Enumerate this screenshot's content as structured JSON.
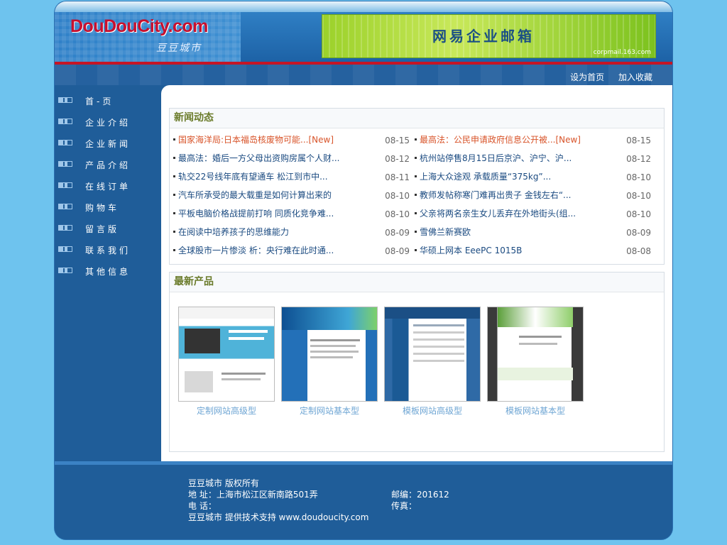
{
  "header": {
    "logo": "DouDouCity.com",
    "logo_sub": "豆豆城市",
    "banner_title": "网易企业邮箱",
    "banner_url": "corpmail.163.com",
    "links": [
      "设为首页",
      "加入收藏"
    ]
  },
  "nav": [
    "首-页",
    "企业介绍",
    "企业新闻",
    "产品介绍",
    "在线订单",
    "购物车",
    "留言版",
    "联系我们",
    "其他信息"
  ],
  "news": {
    "title": "新闻动态",
    "left": [
      {
        "title": "国家海洋局:日本福岛核废物可能...[New]",
        "date": "08-15",
        "hot": true
      },
      {
        "title": "最高法：婚后一方父母出资购房属个人财...",
        "date": "08-12",
        "hot": false
      },
      {
        "title": "轨交22号线年底有望通车 松江到市中...",
        "date": "08-11",
        "hot": false
      },
      {
        "title": "汽车所承受的最大载重是如何计算出来的",
        "date": "08-10",
        "hot": false
      },
      {
        "title": "平板电脑价格战提前打响 同质化竞争难...",
        "date": "08-10",
        "hot": false
      },
      {
        "title": "在阅读中培养孩子的思维能力",
        "date": "08-09",
        "hot": false
      },
      {
        "title": "全球股市一片惨淡 析：央行难在此时通...",
        "date": "08-09",
        "hot": false
      }
    ],
    "right": [
      {
        "title": "最高法：公民申请政府信息公开被...[New]",
        "date": "08-15",
        "hot": true
      },
      {
        "title": "杭州站停售8月15日后京沪、沪宁、沪...",
        "date": "08-12",
        "hot": false
      },
      {
        "title": "上海大众途观 承载质量“375kg”...",
        "date": "08-10",
        "hot": false
      },
      {
        "title": "教师发帖称寒门难再出贵子 金钱左右“...",
        "date": "08-10",
        "hot": false
      },
      {
        "title": "父亲将两名亲生女儿丢弃在外地街头(组...",
        "date": "08-10",
        "hot": false
      },
      {
        "title": "雪佛兰新赛欧",
        "date": "08-09",
        "hot": false
      },
      {
        "title": "华硕上网本 EeePC 1015B",
        "date": "08-08",
        "hot": false
      }
    ]
  },
  "products": {
    "title": "最新产品",
    "items": [
      {
        "name": "定制网站高级型"
      },
      {
        "name": "定制网站基本型"
      },
      {
        "name": "模板网站高级型"
      },
      {
        "name": "模板网站基本型"
      }
    ]
  },
  "footer": {
    "copyright": "豆豆城市 版权所有",
    "address": "地 址：上海市松江区新南路501弄",
    "postcode": "邮编：201612",
    "phone": "电 话：",
    "fax": "传真：",
    "support": "豆豆城市 提供技术支持 www.doudoucity.com"
  }
}
